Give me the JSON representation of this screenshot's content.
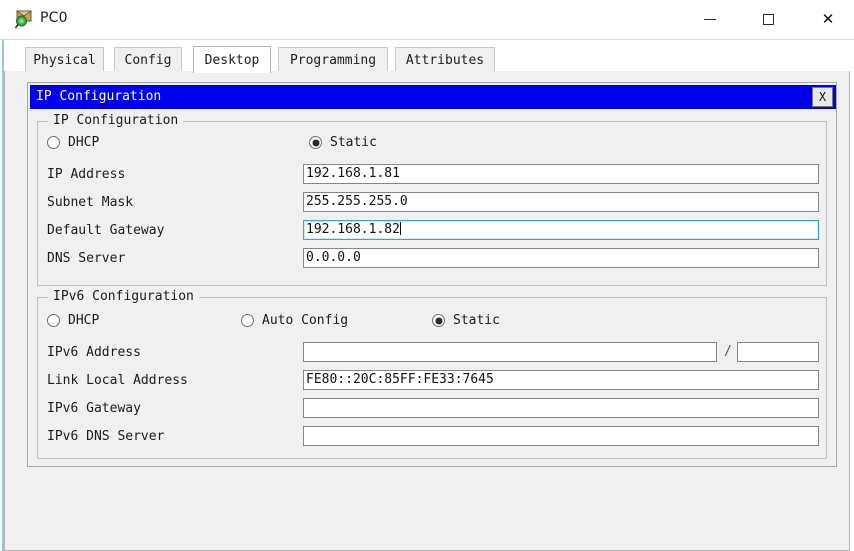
{
  "window": {
    "title": "PC0",
    "icon": "packet-tracer-device-icon",
    "controls": {
      "minimize": "–",
      "maximize": "□",
      "close": "✕"
    }
  },
  "tabs": [
    {
      "label": "Physical",
      "active": false
    },
    {
      "label": "Config",
      "active": false
    },
    {
      "label": "Desktop",
      "active": true
    },
    {
      "label": "Programming",
      "active": false
    },
    {
      "label": "Attributes",
      "active": false
    }
  ],
  "ip_config_window": {
    "title": "IP Configuration",
    "close_label": "X",
    "title_bar_color": "#0000ee"
  },
  "ipv4": {
    "legend": "IP Configuration",
    "mode_options": [
      {
        "label": "DHCP",
        "selected": false
      },
      {
        "label": "Static",
        "selected": true
      }
    ],
    "fields": [
      {
        "label": "IP Address",
        "value": "192.168.1.81",
        "focused": false
      },
      {
        "label": "Subnet Mask",
        "value": "255.255.255.0",
        "focused": false
      },
      {
        "label": "Default Gateway",
        "value": "192.168.1.82",
        "focused": true
      },
      {
        "label": "DNS Server",
        "value": "0.0.0.0",
        "focused": false
      }
    ]
  },
  "ipv6": {
    "legend": "IPv6 Configuration",
    "mode_options": [
      {
        "label": "DHCP",
        "selected": false
      },
      {
        "label": "Auto Config",
        "selected": false
      },
      {
        "label": "Static",
        "selected": true
      }
    ],
    "address_label": "IPv6 Address",
    "address_value": "",
    "prefix_separator": "/",
    "prefix_value": "",
    "fields": [
      {
        "label": "Link Local Address",
        "value": "FE80::20C:85FF:FE33:7645"
      },
      {
        "label": "IPv6 Gateway",
        "value": ""
      },
      {
        "label": "IPv6 DNS Server",
        "value": ""
      }
    ]
  }
}
